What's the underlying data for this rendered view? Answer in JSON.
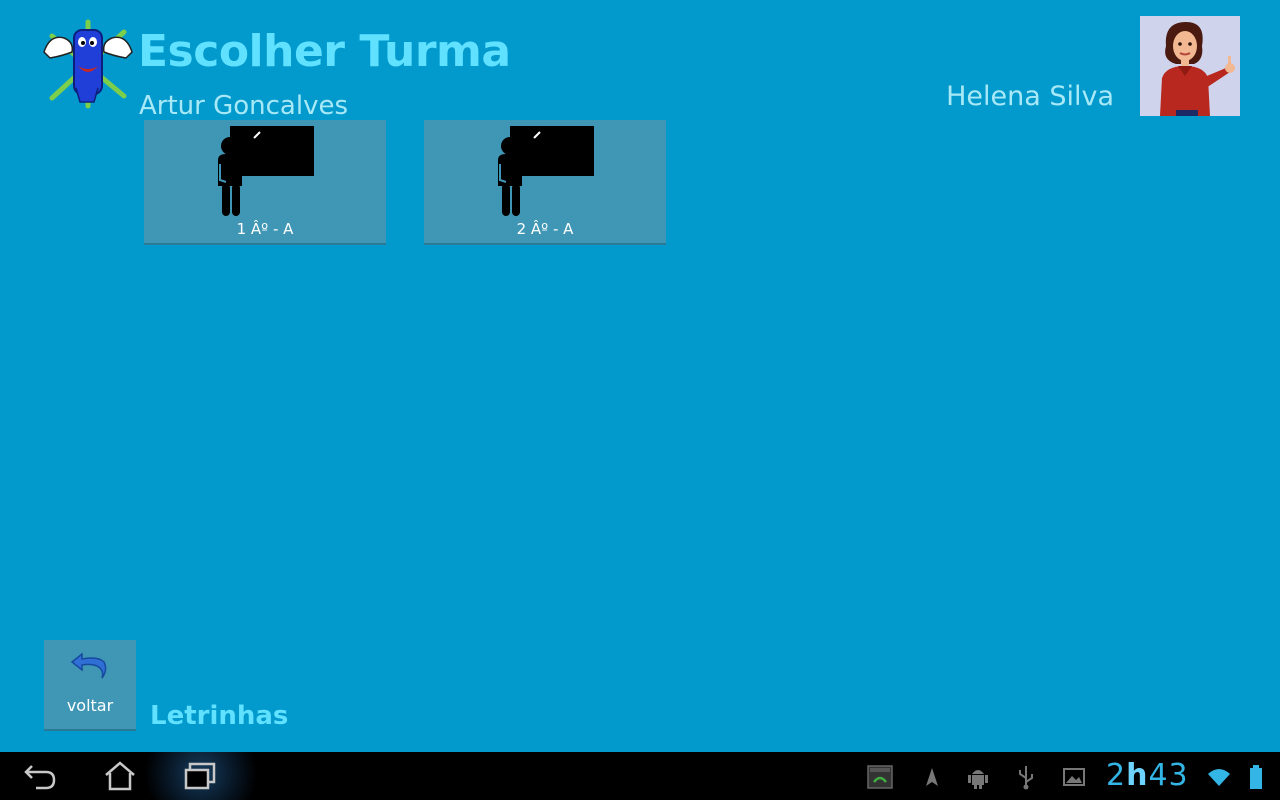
{
  "header": {
    "title": "Escolher Turma",
    "student_name": "Artur Goncalves",
    "teacher_name": "Helena Silva"
  },
  "classes": [
    {
      "label": "1 Âº - A",
      "icon": "teacher-at-board-icon"
    },
    {
      "label": "2 Âº - A",
      "icon": "teacher-at-board-icon"
    }
  ],
  "footer": {
    "back_label": "voltar",
    "app_name": "Letrinhas"
  },
  "system_bar": {
    "clock_hours": "2",
    "clock_sep": "h",
    "clock_minutes": "43",
    "icons": [
      "back-icon",
      "home-icon",
      "recent-apps-icon",
      "screenshot-icon",
      "navigation-icon",
      "android-debug-icon",
      "usb-icon",
      "gallery-icon",
      "wifi-icon",
      "battery-icon"
    ]
  },
  "colors": {
    "background": "#0299cc",
    "title": "#5fe1ff",
    "subtitle": "#a8e9f7",
    "tile": "#3f96b5",
    "clock": "#33b5e5"
  }
}
